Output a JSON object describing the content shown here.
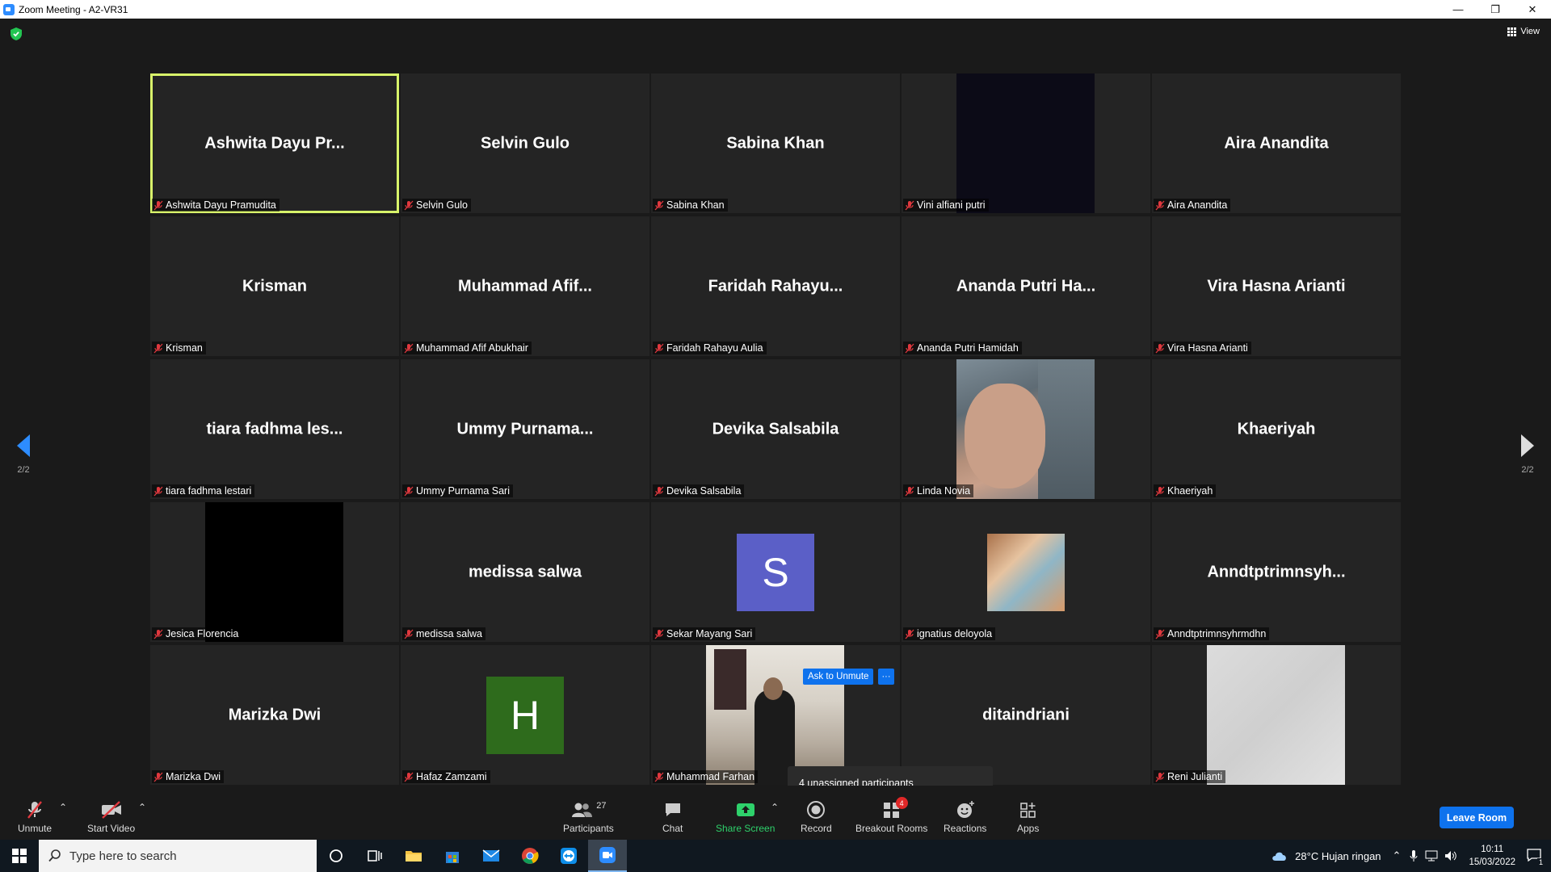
{
  "window": {
    "title": "Zoom Meeting - A2-VR31",
    "minimize": "—",
    "restore": "❐",
    "close": "✕"
  },
  "view_button": {
    "label": "View"
  },
  "tiles": [
    {
      "big": "Ashwita Dayu Pr...",
      "label": "Ashwita Dayu Pramudita",
      "kind": "name",
      "active": true
    },
    {
      "big": "Selvin Gulo",
      "label": "Selvin Gulo",
      "kind": "name"
    },
    {
      "big": "Sabina Khan",
      "label": "Sabina Khan",
      "kind": "name"
    },
    {
      "big": "",
      "label": "Vini alfiani putri",
      "kind": "video-dark"
    },
    {
      "big": "Aira Anandita",
      "label": "Aira Anandita",
      "kind": "name"
    },
    {
      "big": "Krisman",
      "label": "Krisman",
      "kind": "name"
    },
    {
      "big": "Muhammad  Afif...",
      "label": "Muhammad Afif Abukhair",
      "kind": "name"
    },
    {
      "big": "Faridah  Rahayu...",
      "label": "Faridah Rahayu Aulia",
      "kind": "name"
    },
    {
      "big": "Ananda  Putri  Ha...",
      "label": "Ananda Putri Hamidah",
      "kind": "name"
    },
    {
      "big": "Vira Hasna Arianti",
      "label": "Vira Hasna Arianti",
      "kind": "name"
    },
    {
      "big": "tiara  fadhma  les...",
      "label": "tiara fadhma lestari",
      "kind": "name"
    },
    {
      "big": "Ummy  Purnama...",
      "label": "Ummy Purnama Sari",
      "kind": "name"
    },
    {
      "big": "Devika Salsabila",
      "label": "Devika Salsabila",
      "kind": "name"
    },
    {
      "big": "",
      "label": "Linda Novia",
      "kind": "video-girl"
    },
    {
      "big": "Khaeriyah",
      "label": "Khaeriyah",
      "kind": "name"
    },
    {
      "big": "",
      "label": "Jesica Florencia",
      "kind": "video-black"
    },
    {
      "big": "medissa salwa",
      "label": "medissa salwa",
      "kind": "name"
    },
    {
      "big": "",
      "label": "Sekar Mayang Sari",
      "kind": "avatar",
      "letter": "S",
      "color": "#5b5fc7"
    },
    {
      "big": "",
      "label": "ignatius deloyola",
      "kind": "thumb"
    },
    {
      "big": "Anndtptrimnsyh...",
      "label": "Anndtptrimnsyhrmdhn",
      "kind": "name"
    },
    {
      "big": "Marizka Dwi",
      "label": "Marizka Dwi",
      "kind": "name"
    },
    {
      "big": "",
      "label": "Hafaz Zamzami",
      "kind": "avatar",
      "letter": "H",
      "color": "#2e6b1c"
    },
    {
      "big": "",
      "label": "Muhammad Farhan",
      "kind": "video-man"
    },
    {
      "big": "ditaindriani",
      "label": "ditaindriani",
      "kind": "name"
    },
    {
      "big": "",
      "label": "Reni Julianti",
      "kind": "video-light"
    }
  ],
  "overlay": {
    "ask_to_unmute": "Ask to Unmute",
    "more": "···",
    "unassigned": "4 unassigned participants"
  },
  "pager": {
    "left": "2/2",
    "right": "2/2"
  },
  "toolbar": {
    "unmute": "Unmute",
    "start_video": "Start Video",
    "participants": "Participants",
    "participants_count": "27",
    "chat": "Chat",
    "share_screen": "Share Screen",
    "record": "Record",
    "breakout_rooms": "Breakout Rooms",
    "breakout_badge": "4",
    "reactions": "Reactions",
    "apps": "Apps",
    "leave_room": "Leave Room",
    "caret": "⌃"
  },
  "taskbar": {
    "search_placeholder": "Type here to search",
    "weather": "28°C  Hujan ringan",
    "time": "10:11",
    "date": "15/03/2022",
    "notification_count": "1"
  },
  "colors": {
    "accent": "#0e72ed",
    "active_speaker": "#d8f36a",
    "share_green": "#2ed16b",
    "mute_red": "#e0383e"
  }
}
